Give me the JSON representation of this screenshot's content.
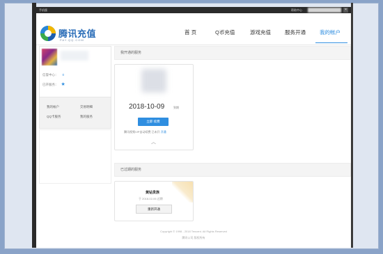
{
  "topbar": {
    "left_text": "手机版",
    "right_text": "帮助中心"
  },
  "brand": {
    "title": "腾讯充值",
    "subtitle": "PAY.QQ.COM"
  },
  "nav": [
    {
      "label": "首 页"
    },
    {
      "label": "Q币充值"
    },
    {
      "label": "游戏充值"
    },
    {
      "label": "服务开通"
    },
    {
      "label": "我的帐户"
    }
  ],
  "profile": {
    "row1_label": "信誉中心：",
    "row1_value": "0",
    "row2_label": "已开服务："
  },
  "sidebar_links": [
    "我的帐户",
    "交易明细",
    "QQ卡服务",
    "我的服务"
  ],
  "opened_section": {
    "title": "我开通的服务"
  },
  "service": {
    "date": "2018-10-09",
    "date_suffix": "到期",
    "renew_label": "立即 续费",
    "note": "腾讯视频VIP自动续费 已未开",
    "note_link": "开通"
  },
  "expired_section": {
    "title": "已过期的服务"
  },
  "expired": {
    "name": "黄钻贵族",
    "date": "于 2018-02-06 过期",
    "reopen_label": "重新开通"
  },
  "footer": {
    "line1": "Copyright © 1998 - 2018 Tencent. All Rights Reserved",
    "line2": "腾讯公司 版权所有"
  },
  "colors": {
    "accent": "#2f8ee0",
    "frame": "#8aa3c8"
  }
}
